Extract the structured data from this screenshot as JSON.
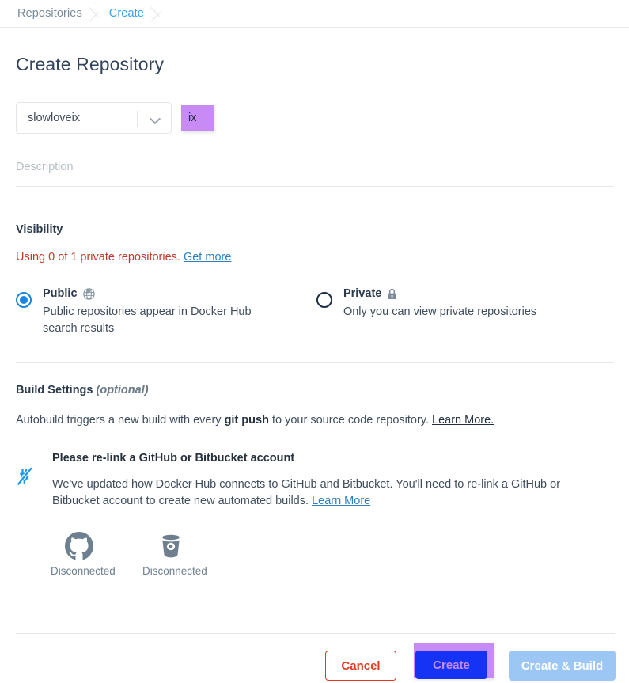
{
  "breadcrumb": {
    "items": [
      {
        "label": "Repositories",
        "active": false
      },
      {
        "label": "Create",
        "active": true
      }
    ]
  },
  "page": {
    "title": "Create Repository"
  },
  "name_row": {
    "namespace_value": "slowloveix",
    "namespace_icon": "chevron-down-icon",
    "repo_name_value": "ix",
    "repo_name_highlighted": true,
    "highlight_color": "#c88bf5"
  },
  "description": {
    "placeholder": "Description",
    "value": ""
  },
  "visibility": {
    "section_label": "Visibility",
    "quota_text": "Using 0 of 1 private repositories.",
    "quota_link": "Get more",
    "quota_color": "#c0392b",
    "link_color": "#2d7fc1",
    "options": [
      {
        "id": "public",
        "title": "Public",
        "icon": "globe-icon",
        "description": "Public repositories appear in Docker Hub search results",
        "selected": true
      },
      {
        "id": "private",
        "title": "Private",
        "icon": "lock-icon",
        "description": "Only you can view private repositories",
        "selected": false
      }
    ]
  },
  "build_settings": {
    "heading": "Build Settings",
    "heading_optional": "(optional)",
    "autobuild_prefix": "Autobuild triggers a new build with every ",
    "autobuild_bold": "git push",
    "autobuild_suffix": " to your source code repository. ",
    "autobuild_link": "Learn More."
  },
  "notice": {
    "icon": "unplugged-icon",
    "icon_color": "#1b9bed",
    "title": "Please re-link a GitHub or Bitbucket account",
    "text": "We've updated how Docker Hub connects to GitHub and Bitbucket. You'll need to re-link a GitHub or Bitbucket account to create new automated builds. ",
    "link": "Learn More"
  },
  "providers": [
    {
      "icon": "github-icon",
      "name": "GitHub",
      "status": "Disconnected"
    },
    {
      "icon": "bitbucket-icon",
      "name": "Bitbucket",
      "status": "Disconnected"
    }
  ],
  "footer": {
    "cancel_label": "Cancel",
    "create_label": "Create",
    "create_and_build_label": "Create & Build",
    "create_highlighted": true,
    "cancel_color": "#e03b1c",
    "create_bg": "#1533f5",
    "create_text_color": "#c88bf5",
    "build_bg": "#9cc7f4"
  }
}
